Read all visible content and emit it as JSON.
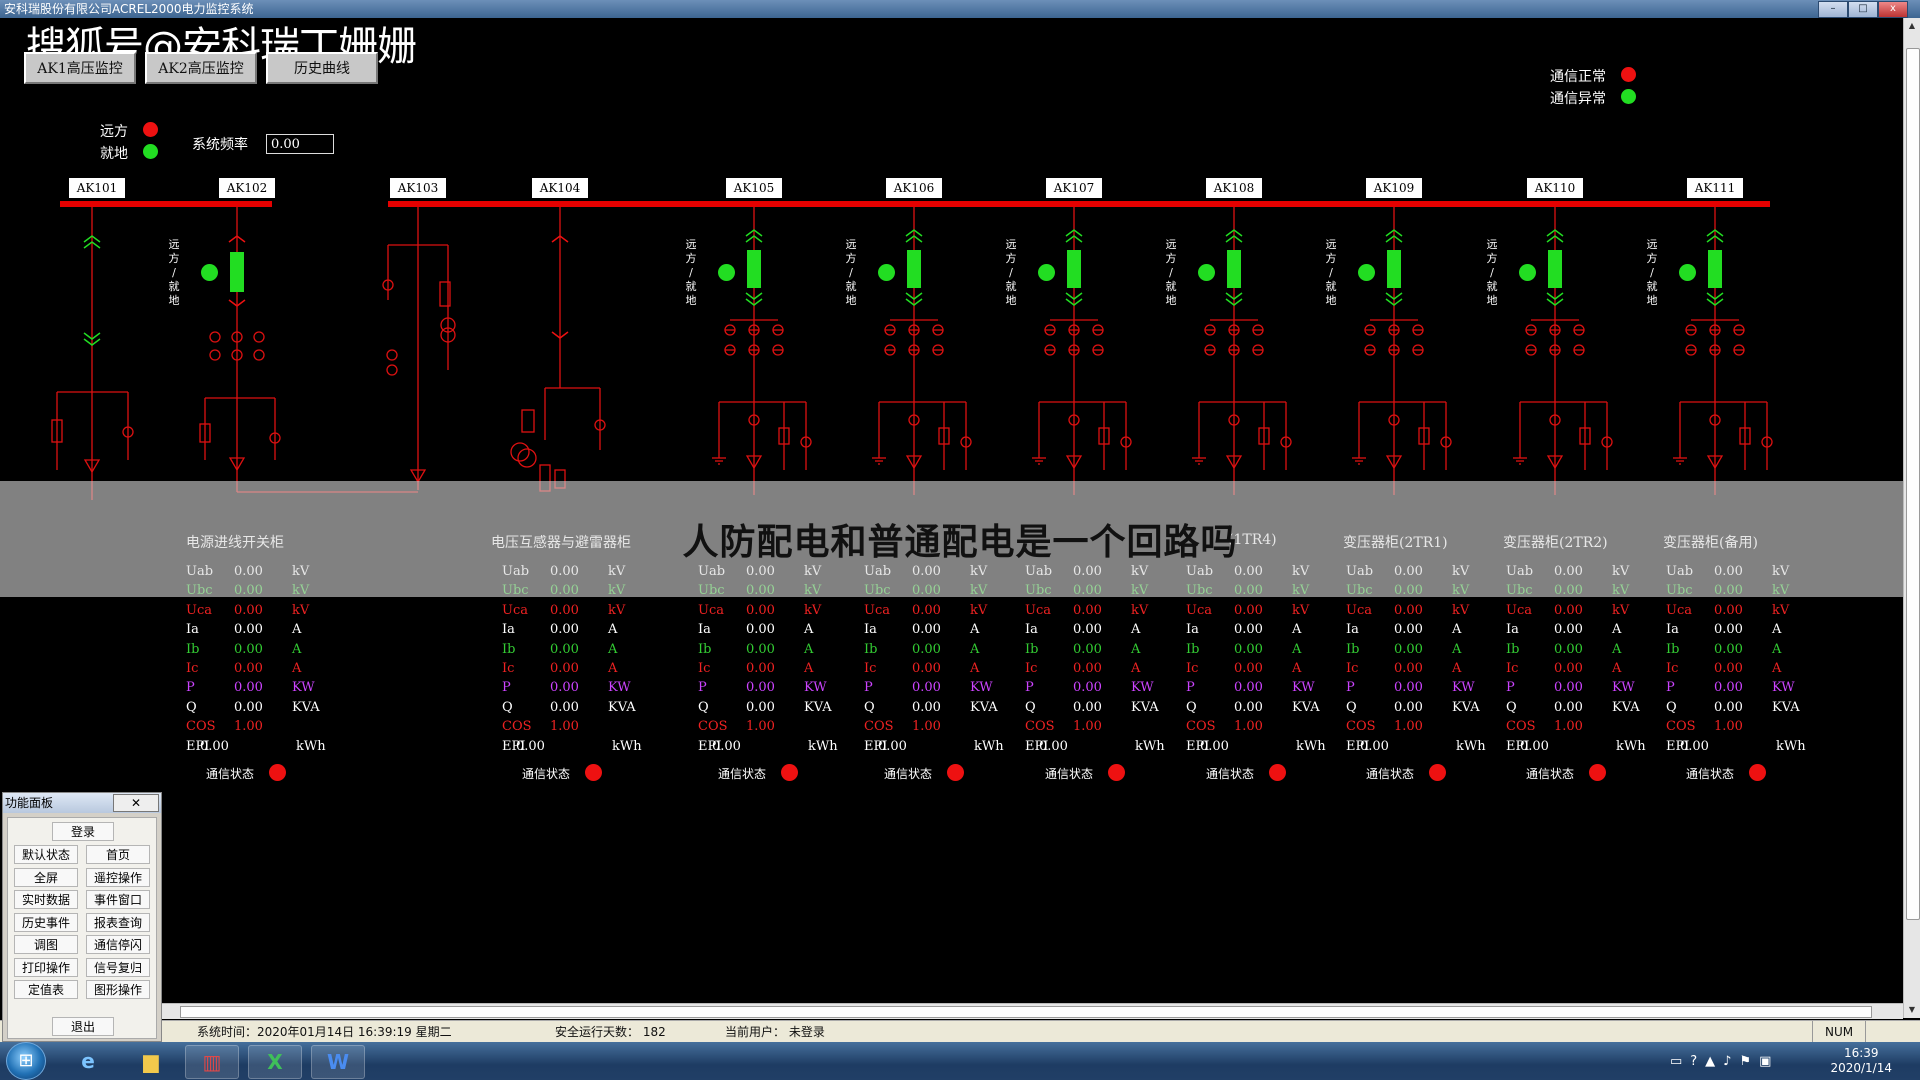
{
  "window": {
    "title": "安科瑞股份有限公司ACREL2000电力监控系统"
  },
  "watermark": "搜狐号@安科瑞丁姗姗",
  "nav": {
    "ak1": "AK1高压监控",
    "ak2": "AK2高压监控",
    "history": "历史曲线"
  },
  "legend_tl": {
    "remote": "远方",
    "local": "就地"
  },
  "legend_tr": {
    "comm_ok": "通信正常",
    "comm_err": "通信异常"
  },
  "freq": {
    "label": "系统频率",
    "value": "0.00"
  },
  "cabinets": [
    "AK101",
    "AK102",
    "AK103",
    "AK104",
    "AK105",
    "AK106",
    "AK107",
    "AK108",
    "AK109",
    "AK110",
    "AK111"
  ],
  "switch_label": [
    "远",
    "方",
    "/",
    "就",
    "地"
  ],
  "feeders": [
    {
      "name": "电源进线开关柜"
    },
    {
      "name": "电压互感器与避雷器柜"
    },
    {
      "name": ""
    },
    {
      "name": ""
    },
    {
      "name": ""
    },
    {
      "name": "(1TR4)"
    },
    {
      "name": "变压器柜(2TR1)"
    },
    {
      "name": "变压器柜(2TR2)"
    },
    {
      "name": "变压器柜(备用)"
    }
  ],
  "measure_rows": [
    {
      "label": "Uab",
      "value": "0.00",
      "unit": "kV"
    },
    {
      "label": "Ubc",
      "value": "0.00",
      "unit": "kV"
    },
    {
      "label": "Uca",
      "value": "0.00",
      "unit": "kV"
    },
    {
      "label": "Ia",
      "value": "0.00",
      "unit": "A"
    },
    {
      "label": "Ib",
      "value": "0.00",
      "unit": "A"
    },
    {
      "label": "Ic",
      "value": "0.00",
      "unit": "A"
    },
    {
      "label": "P",
      "value": "0.00",
      "unit": "KW"
    },
    {
      "label": "Q",
      "value": "0.00",
      "unit": "KVA"
    },
    {
      "label": "COS",
      "value": "1.00",
      "unit": ""
    },
    {
      "label": "EPI",
      "value": "0.00",
      "unit": "kWh"
    }
  ],
  "comm_status": "通信状态",
  "headline": "人防配电和普通配电是一个回路吗",
  "panel": {
    "title": "功能面板",
    "close": "✕",
    "login": "登录",
    "buttons": [
      "默认状态",
      "首页",
      "全屏",
      "遥控操作",
      "实时数据",
      "事件窗口",
      "历史事件",
      "报表查询",
      "调图",
      "通信停闪",
      "打印操作",
      "信号复归",
      "定值表",
      "图形操作"
    ],
    "exit": "退出"
  },
  "status": {
    "time": "系统时间：2020年01月14日  16:39:19   星期二",
    "days": "安全运行天数：  182",
    "user": "当前用户：  未登录",
    "num": "NUM"
  },
  "taskbar": {
    "time": "16:39",
    "date": "2020/1/14"
  },
  "colors": {
    "busbar": "#e60000",
    "ok_green": "#22dd22",
    "alarm_red": "#ee1111",
    "line_red": "#dd1111",
    "ubc_green": "#33cc33",
    "uca_red": "#ee2222",
    "p_purple": "#cc44ff"
  }
}
